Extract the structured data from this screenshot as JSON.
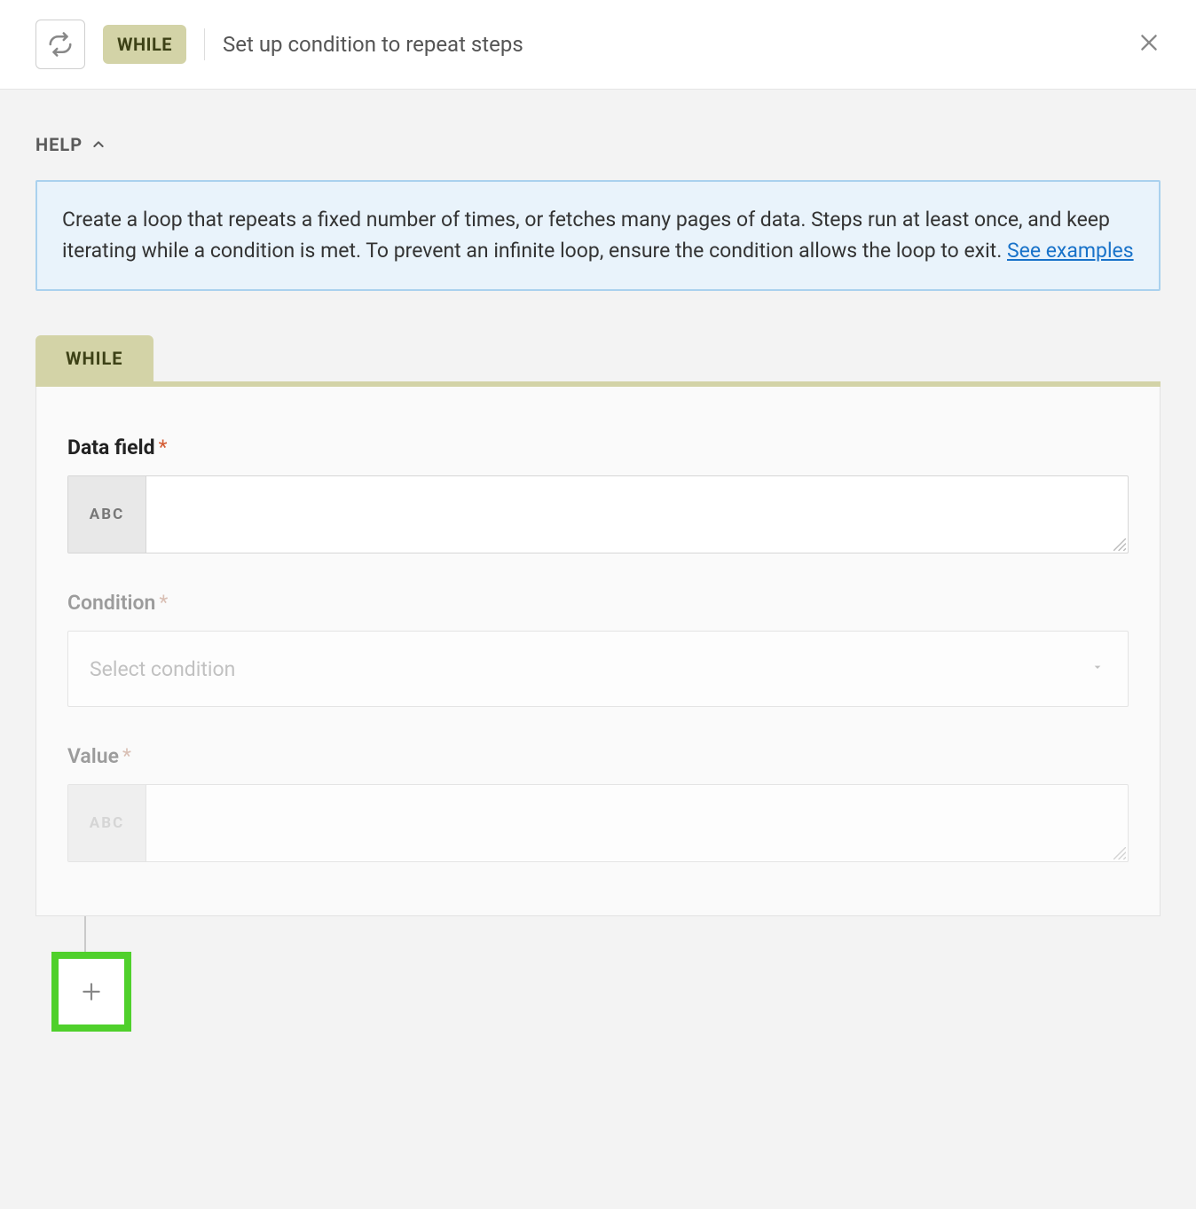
{
  "header": {
    "badge": "WHILE",
    "title": "Set up condition to repeat steps"
  },
  "help": {
    "toggle_label": "HELP",
    "body": "Create a loop that repeats a fixed number of times, or fetches many pages of data. Steps run at least once, and keep iterating while a condition is met. To prevent an infinite loop, ensure the condition allows the loop to exit. ",
    "link_text": "See examples"
  },
  "section": {
    "tab_label": "WHILE"
  },
  "fields": {
    "data_field": {
      "label": "Data field",
      "type_hint": "ABC",
      "value": ""
    },
    "condition": {
      "label": "Condition",
      "placeholder": "Select condition"
    },
    "value": {
      "label": "Value",
      "type_hint": "ABC",
      "value": ""
    }
  }
}
